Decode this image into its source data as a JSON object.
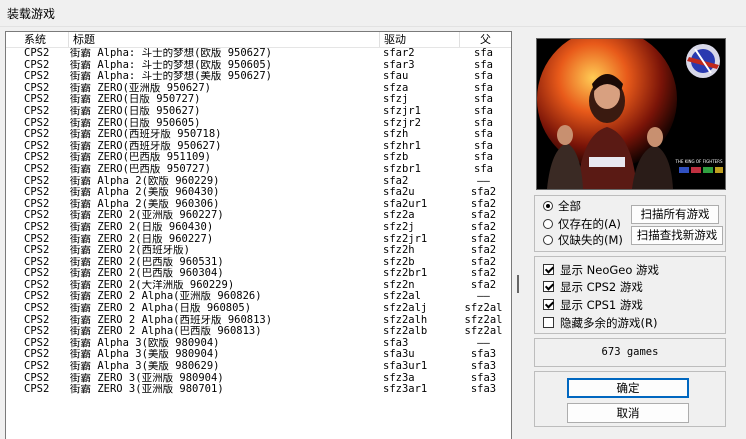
{
  "window": {
    "title": "装载游戏"
  },
  "columns": {
    "system": "系统",
    "title": "标题",
    "driver": "驱动",
    "parent": "父"
  },
  "rows": [
    {
      "system": "CPS2",
      "title": "街霸 Alpha: 斗士的梦想(欧版 950627)",
      "driver": "sfar2",
      "parent": "sfa"
    },
    {
      "system": "CPS2",
      "title": "街霸 Alpha: 斗士的梦想(欧版 950605)",
      "driver": "sfar3",
      "parent": "sfa"
    },
    {
      "system": "CPS2",
      "title": "街霸 Alpha: 斗士的梦想(美版 950627)",
      "driver": "sfau",
      "parent": "sfa"
    },
    {
      "system": "CPS2",
      "title": "街霸 ZERO(亚洲版 950627)",
      "driver": "sfza",
      "parent": "sfa"
    },
    {
      "system": "CPS2",
      "title": "街霸 ZERO(日版 950727)",
      "driver": "sfzj",
      "parent": "sfa"
    },
    {
      "system": "CPS2",
      "title": "街霸 ZERO(日版 950627)",
      "driver": "sfzjr1",
      "parent": "sfa"
    },
    {
      "system": "CPS2",
      "title": "街霸 ZERO(日版 950605)",
      "driver": "sfzjr2",
      "parent": "sfa"
    },
    {
      "system": "CPS2",
      "title": "街霸 ZERO(西班牙版 950718)",
      "driver": "sfzh",
      "parent": "sfa"
    },
    {
      "system": "CPS2",
      "title": "街霸 ZERO(西班牙版 950627)",
      "driver": "sfzhr1",
      "parent": "sfa"
    },
    {
      "system": "CPS2",
      "title": "街霸 ZERO(巴西版 951109)",
      "driver": "sfzb",
      "parent": "sfa"
    },
    {
      "system": "CPS2",
      "title": "街霸 ZERO(巴西版 950727)",
      "driver": "sfzbr1",
      "parent": "sfa"
    },
    {
      "system": "CPS2",
      "title": "街霸 Alpha 2(欧版 960229)",
      "driver": "sfa2",
      "parent": "——"
    },
    {
      "system": "CPS2",
      "title": "街霸 Alpha 2(美版 960430)",
      "driver": "sfa2u",
      "parent": "sfa2"
    },
    {
      "system": "CPS2",
      "title": "街霸 Alpha 2(美版 960306)",
      "driver": "sfa2ur1",
      "parent": "sfa2"
    },
    {
      "system": "CPS2",
      "title": "街霸 ZERO 2(亚洲版 960227)",
      "driver": "sfz2a",
      "parent": "sfa2"
    },
    {
      "system": "CPS2",
      "title": "街霸 ZERO 2(日版 960430)",
      "driver": "sfz2j",
      "parent": "sfa2"
    },
    {
      "system": "CPS2",
      "title": "街霸 ZERO 2(日版 960227)",
      "driver": "sfz2jr1",
      "parent": "sfa2"
    },
    {
      "system": "CPS2",
      "title": "街霸 ZERO 2(西班牙版)",
      "driver": "sfz2h",
      "parent": "sfa2"
    },
    {
      "system": "CPS2",
      "title": "街霸 ZERO 2(巴西版 960531)",
      "driver": "sfz2b",
      "parent": "sfa2"
    },
    {
      "system": "CPS2",
      "title": "街霸 ZERO 2(巴西版 960304)",
      "driver": "sfz2br1",
      "parent": "sfa2"
    },
    {
      "system": "CPS2",
      "title": "街霸 ZERO 2(大洋洲版 960229)",
      "driver": "sfz2n",
      "parent": "sfa2"
    },
    {
      "system": "CPS2",
      "title": "街霸 ZERO 2 Alpha(亚洲版 960826)",
      "driver": "sfz2al",
      "parent": "——"
    },
    {
      "system": "CPS2",
      "title": "街霸 ZERO 2 Alpha(日版 960805)",
      "driver": "sfz2alj",
      "parent": "sfz2al"
    },
    {
      "system": "CPS2",
      "title": "街霸 ZERO 2 Alpha(西班牙版 960813)",
      "driver": "sfz2alh",
      "parent": "sfz2al"
    },
    {
      "system": "CPS2",
      "title": "街霸 ZERO 2 Alpha(巴西版 960813)",
      "driver": "sfz2alb",
      "parent": "sfz2al"
    },
    {
      "system": "CPS2",
      "title": "街霸 Alpha 3(欧版 980904)",
      "driver": "sfa3",
      "parent": "——"
    },
    {
      "system": "CPS2",
      "title": "街霸 Alpha 3(美版 980904)",
      "driver": "sfa3u",
      "parent": "sfa3"
    },
    {
      "system": "CPS2",
      "title": "街霸 Alpha 3(美版 980629)",
      "driver": "sfa3ur1",
      "parent": "sfa3"
    },
    {
      "system": "CPS2",
      "title": "街霸 ZERO 3(亚洲版 980904)",
      "driver": "sfz3a",
      "parent": "sfa3"
    },
    {
      "system": "CPS2",
      "title": "街霸 ZERO 3(亚洲版 980701)",
      "driver": "sfz3ar1",
      "parent": "sfa3"
    }
  ],
  "filter": {
    "all": "全部",
    "available": "仅存在的(A)",
    "missing": "仅缺失的(M)",
    "selected": "all"
  },
  "buttons": {
    "scan_all": "扫描所有游戏",
    "scan_new": "扫描查找新游戏",
    "ok": "确定",
    "cancel": "取消"
  },
  "options": {
    "neogeo": {
      "label": "显示 NeoGeo 游戏",
      "checked": true
    },
    "cps2": {
      "label": "显示 CPS2 游戏",
      "checked": true
    },
    "cps1": {
      "label": "显示 CPS1 游戏",
      "checked": true
    },
    "hide_dup": {
      "label": "隐藏多余的游戏(R)",
      "checked": false
    }
  },
  "status": {
    "count_text": "673 games"
  },
  "preview": {
    "logo_text": "THE KING OF FIGHTERS",
    "bg_color": "#000000",
    "accent_color": "#c0281c"
  }
}
